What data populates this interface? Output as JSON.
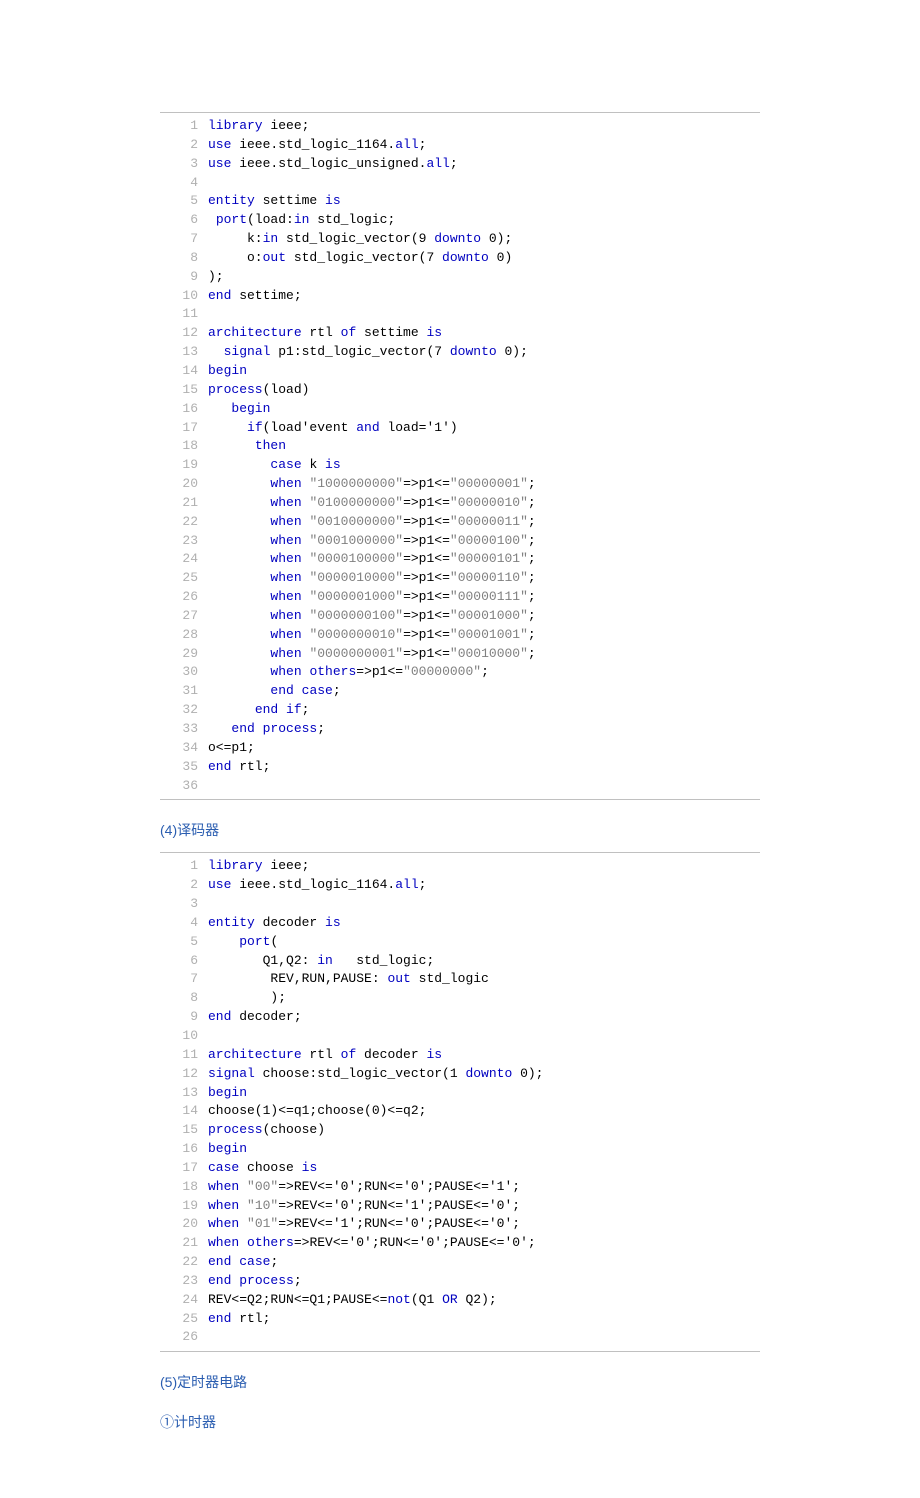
{
  "code1": {
    "lines": [
      {
        "n": "1",
        "tokens": [
          [
            "kw",
            "library"
          ],
          [
            "id",
            " ieee;"
          ]
        ]
      },
      {
        "n": "2",
        "tokens": [
          [
            "kw",
            "use"
          ],
          [
            "id",
            " ieee.std_logic_1164."
          ],
          [
            "kw",
            "all"
          ],
          [
            "id",
            ";"
          ]
        ]
      },
      {
        "n": "3",
        "tokens": [
          [
            "kw",
            "use"
          ],
          [
            "id",
            " ieee.std_logic_unsigned."
          ],
          [
            "kw",
            "all"
          ],
          [
            "id",
            ";"
          ]
        ]
      },
      {
        "n": "4",
        "tokens": []
      },
      {
        "n": "5",
        "tokens": [
          [
            "kw",
            "entity"
          ],
          [
            "id",
            " settime "
          ],
          [
            "kw",
            "is"
          ]
        ]
      },
      {
        "n": "6",
        "tokens": [
          [
            "id",
            " "
          ],
          [
            "kw",
            "port"
          ],
          [
            "id",
            "(load:"
          ],
          [
            "kw",
            "in"
          ],
          [
            "id",
            " std_logic;"
          ]
        ]
      },
      {
        "n": "7",
        "tokens": [
          [
            "id",
            "     k:"
          ],
          [
            "kw",
            "in"
          ],
          [
            "id",
            " std_logic_vector(9 "
          ],
          [
            "kw",
            "downto"
          ],
          [
            "id",
            " 0);"
          ]
        ]
      },
      {
        "n": "8",
        "tokens": [
          [
            "id",
            "     o:"
          ],
          [
            "kw",
            "out"
          ],
          [
            "id",
            " std_logic_vector(7 "
          ],
          [
            "kw",
            "downto"
          ],
          [
            "id",
            " 0)"
          ]
        ]
      },
      {
        "n": "9",
        "tokens": [
          [
            "id",
            ");"
          ]
        ]
      },
      {
        "n": "10",
        "tokens": [
          [
            "kw",
            "end"
          ],
          [
            "id",
            " settime;"
          ]
        ]
      },
      {
        "n": "11",
        "tokens": []
      },
      {
        "n": "12",
        "tokens": [
          [
            "kw",
            "architecture"
          ],
          [
            "id",
            " rtl "
          ],
          [
            "kw",
            "of"
          ],
          [
            "id",
            " settime "
          ],
          [
            "kw",
            "is"
          ]
        ]
      },
      {
        "n": "13",
        "tokens": [
          [
            "id",
            "  "
          ],
          [
            "kw",
            "signal"
          ],
          [
            "id",
            " p1:std_logic_vector(7 "
          ],
          [
            "kw",
            "downto"
          ],
          [
            "id",
            " 0);"
          ]
        ]
      },
      {
        "n": "14",
        "tokens": [
          [
            "kw",
            "begin"
          ]
        ]
      },
      {
        "n": "15",
        "tokens": [
          [
            "kw",
            "process"
          ],
          [
            "id",
            "(load)"
          ]
        ]
      },
      {
        "n": "16",
        "tokens": [
          [
            "id",
            "   "
          ],
          [
            "kw",
            "begin"
          ]
        ]
      },
      {
        "n": "17",
        "tokens": [
          [
            "id",
            "     "
          ],
          [
            "kw",
            "if"
          ],
          [
            "id",
            "(load'event "
          ],
          [
            "kw",
            "and"
          ],
          [
            "id",
            " load='1')"
          ]
        ]
      },
      {
        "n": "18",
        "tokens": [
          [
            "id",
            "      "
          ],
          [
            "kw",
            "then"
          ]
        ]
      },
      {
        "n": "19",
        "tokens": [
          [
            "id",
            "        "
          ],
          [
            "kw",
            "case"
          ],
          [
            "id",
            " k "
          ],
          [
            "kw",
            "is"
          ]
        ]
      },
      {
        "n": "20",
        "tokens": [
          [
            "id",
            "        "
          ],
          [
            "kw",
            "when"
          ],
          [
            "id",
            " "
          ],
          [
            "str",
            "\"1000000000\""
          ],
          [
            "id",
            "=>p1<="
          ],
          [
            "str",
            "\"00000001\""
          ],
          [
            "id",
            ";"
          ]
        ]
      },
      {
        "n": "21",
        "tokens": [
          [
            "id",
            "        "
          ],
          [
            "kw",
            "when"
          ],
          [
            "id",
            " "
          ],
          [
            "str",
            "\"0100000000\""
          ],
          [
            "id",
            "=>p1<="
          ],
          [
            "str",
            "\"00000010\""
          ],
          [
            "id",
            ";"
          ]
        ]
      },
      {
        "n": "22",
        "tokens": [
          [
            "id",
            "        "
          ],
          [
            "kw",
            "when"
          ],
          [
            "id",
            " "
          ],
          [
            "str",
            "\"0010000000\""
          ],
          [
            "id",
            "=>p1<="
          ],
          [
            "str",
            "\"00000011\""
          ],
          [
            "id",
            ";"
          ]
        ]
      },
      {
        "n": "23",
        "tokens": [
          [
            "id",
            "        "
          ],
          [
            "kw",
            "when"
          ],
          [
            "id",
            " "
          ],
          [
            "str",
            "\"0001000000\""
          ],
          [
            "id",
            "=>p1<="
          ],
          [
            "str",
            "\"00000100\""
          ],
          [
            "id",
            ";"
          ]
        ]
      },
      {
        "n": "24",
        "tokens": [
          [
            "id",
            "        "
          ],
          [
            "kw",
            "when"
          ],
          [
            "id",
            " "
          ],
          [
            "str",
            "\"0000100000\""
          ],
          [
            "id",
            "=>p1<="
          ],
          [
            "str",
            "\"00000101\""
          ],
          [
            "id",
            ";"
          ]
        ]
      },
      {
        "n": "25",
        "tokens": [
          [
            "id",
            "        "
          ],
          [
            "kw",
            "when"
          ],
          [
            "id",
            " "
          ],
          [
            "str",
            "\"0000010000\""
          ],
          [
            "id",
            "=>p1<="
          ],
          [
            "str",
            "\"00000110\""
          ],
          [
            "id",
            ";"
          ]
        ]
      },
      {
        "n": "26",
        "tokens": [
          [
            "id",
            "        "
          ],
          [
            "kw",
            "when"
          ],
          [
            "id",
            " "
          ],
          [
            "str",
            "\"0000001000\""
          ],
          [
            "id",
            "=>p1<="
          ],
          [
            "str",
            "\"00000111\""
          ],
          [
            "id",
            ";"
          ]
        ]
      },
      {
        "n": "27",
        "tokens": [
          [
            "id",
            "        "
          ],
          [
            "kw",
            "when"
          ],
          [
            "id",
            " "
          ],
          [
            "str",
            "\"0000000100\""
          ],
          [
            "id",
            "=>p1<="
          ],
          [
            "str",
            "\"00001000\""
          ],
          [
            "id",
            ";"
          ]
        ]
      },
      {
        "n": "28",
        "tokens": [
          [
            "id",
            "        "
          ],
          [
            "kw",
            "when"
          ],
          [
            "id",
            " "
          ],
          [
            "str",
            "\"0000000010\""
          ],
          [
            "id",
            "=>p1<="
          ],
          [
            "str",
            "\"00001001\""
          ],
          [
            "id",
            ";"
          ]
        ]
      },
      {
        "n": "29",
        "tokens": [
          [
            "id",
            "        "
          ],
          [
            "kw",
            "when"
          ],
          [
            "id",
            " "
          ],
          [
            "str",
            "\"0000000001\""
          ],
          [
            "id",
            "=>p1<="
          ],
          [
            "str",
            "\"00010000\""
          ],
          [
            "id",
            ";"
          ]
        ]
      },
      {
        "n": "30",
        "tokens": [
          [
            "id",
            "        "
          ],
          [
            "kw",
            "when"
          ],
          [
            "id",
            " "
          ],
          [
            "kw",
            "others"
          ],
          [
            "id",
            "=>p1<="
          ],
          [
            "str",
            "\"00000000\""
          ],
          [
            "id",
            ";"
          ]
        ]
      },
      {
        "n": "31",
        "tokens": [
          [
            "id",
            "        "
          ],
          [
            "kw",
            "end"
          ],
          [
            "id",
            " "
          ],
          [
            "kw",
            "case"
          ],
          [
            "id",
            ";"
          ]
        ]
      },
      {
        "n": "32",
        "tokens": [
          [
            "id",
            "      "
          ],
          [
            "kw",
            "end"
          ],
          [
            "id",
            " "
          ],
          [
            "kw",
            "if"
          ],
          [
            "id",
            ";"
          ]
        ]
      },
      {
        "n": "33",
        "tokens": [
          [
            "id",
            "   "
          ],
          [
            "kw",
            "end"
          ],
          [
            "id",
            " "
          ],
          [
            "kw",
            "process"
          ],
          [
            "id",
            ";"
          ]
        ]
      },
      {
        "n": "34",
        "tokens": [
          [
            "id",
            "o<=p1;"
          ]
        ]
      },
      {
        "n": "35",
        "tokens": [
          [
            "kw",
            "end"
          ],
          [
            "id",
            " rtl;"
          ]
        ]
      },
      {
        "n": "36",
        "tokens": []
      }
    ]
  },
  "heading4": "(4)译码器",
  "code2": {
    "lines": [
      {
        "n": "1",
        "tokens": [
          [
            "kw",
            "library"
          ],
          [
            "id",
            " ieee;"
          ]
        ]
      },
      {
        "n": "2",
        "tokens": [
          [
            "kw",
            "use"
          ],
          [
            "id",
            " ieee.std_logic_1164."
          ],
          [
            "kw",
            "all"
          ],
          [
            "id",
            ";"
          ]
        ]
      },
      {
        "n": "3",
        "tokens": []
      },
      {
        "n": "4",
        "tokens": [
          [
            "kw",
            "entity"
          ],
          [
            "id",
            " decoder "
          ],
          [
            "kw",
            "is"
          ]
        ]
      },
      {
        "n": "5",
        "tokens": [
          [
            "id",
            "    "
          ],
          [
            "kw",
            "port"
          ],
          [
            "id",
            "("
          ]
        ]
      },
      {
        "n": "6",
        "tokens": [
          [
            "id",
            "       Q1,Q2: "
          ],
          [
            "kw",
            "in"
          ],
          [
            "id",
            "   std_logic;"
          ]
        ]
      },
      {
        "n": "7",
        "tokens": [
          [
            "id",
            "        REV,RUN,PAUSE: "
          ],
          [
            "kw",
            "out"
          ],
          [
            "id",
            " std_logic"
          ]
        ]
      },
      {
        "n": "8",
        "tokens": [
          [
            "id",
            "        );"
          ]
        ]
      },
      {
        "n": "9",
        "tokens": [
          [
            "kw",
            "end"
          ],
          [
            "id",
            " decoder;"
          ]
        ]
      },
      {
        "n": "10",
        "tokens": []
      },
      {
        "n": "11",
        "tokens": [
          [
            "kw",
            "architecture"
          ],
          [
            "id",
            " rtl "
          ],
          [
            "kw",
            "of"
          ],
          [
            "id",
            " decoder "
          ],
          [
            "kw",
            "is"
          ]
        ]
      },
      {
        "n": "12",
        "tokens": [
          [
            "kw",
            "signal"
          ],
          [
            "id",
            " choose:std_logic_vector(1 "
          ],
          [
            "kw",
            "downto"
          ],
          [
            "id",
            " 0);"
          ]
        ]
      },
      {
        "n": "13",
        "tokens": [
          [
            "kw",
            "begin"
          ]
        ]
      },
      {
        "n": "14",
        "tokens": [
          [
            "id",
            "choose(1)<=q1;choose(0)<=q2;"
          ]
        ]
      },
      {
        "n": "15",
        "tokens": [
          [
            "kw",
            "process"
          ],
          [
            "id",
            "(choose)"
          ]
        ]
      },
      {
        "n": "16",
        "tokens": [
          [
            "kw",
            "begin"
          ]
        ]
      },
      {
        "n": "17",
        "tokens": [
          [
            "kw",
            "case"
          ],
          [
            "id",
            " choose "
          ],
          [
            "kw",
            "is"
          ]
        ]
      },
      {
        "n": "18",
        "tokens": [
          [
            "kw",
            "when"
          ],
          [
            "id",
            " "
          ],
          [
            "str",
            "\"00\""
          ],
          [
            "id",
            "=>REV<='0';RUN<='0';PAUSE<='1';"
          ]
        ]
      },
      {
        "n": "19",
        "tokens": [
          [
            "kw",
            "when"
          ],
          [
            "id",
            " "
          ],
          [
            "str",
            "\"10\""
          ],
          [
            "id",
            "=>REV<='0';RUN<='1';PAUSE<='0';"
          ]
        ]
      },
      {
        "n": "20",
        "tokens": [
          [
            "kw",
            "when"
          ],
          [
            "id",
            " "
          ],
          [
            "str",
            "\"01\""
          ],
          [
            "id",
            "=>REV<='1';RUN<='0';PAUSE<='0';"
          ]
        ]
      },
      {
        "n": "21",
        "tokens": [
          [
            "kw",
            "when"
          ],
          [
            "id",
            " "
          ],
          [
            "kw",
            "others"
          ],
          [
            "id",
            "=>REV<='0';RUN<='0';PAUSE<='0';"
          ]
        ]
      },
      {
        "n": "22",
        "tokens": [
          [
            "kw",
            "end"
          ],
          [
            "id",
            " "
          ],
          [
            "kw",
            "case"
          ],
          [
            "id",
            ";"
          ]
        ]
      },
      {
        "n": "23",
        "tokens": [
          [
            "kw",
            "end"
          ],
          [
            "id",
            " "
          ],
          [
            "kw",
            "process"
          ],
          [
            "id",
            ";"
          ]
        ]
      },
      {
        "n": "24",
        "tokens": [
          [
            "id",
            "REV<=Q2;RUN<=Q1;PAUSE<="
          ],
          [
            "kw",
            "not"
          ],
          [
            "id",
            "(Q1 "
          ],
          [
            "kw",
            "OR"
          ],
          [
            "id",
            " Q2);"
          ]
        ]
      },
      {
        "n": "25",
        "tokens": [
          [
            "kw",
            "end"
          ],
          [
            "id",
            " rtl;"
          ]
        ]
      },
      {
        "n": "26",
        "tokens": []
      }
    ]
  },
  "heading5": "(5)定时器电路",
  "heading5_1": "①计时器"
}
